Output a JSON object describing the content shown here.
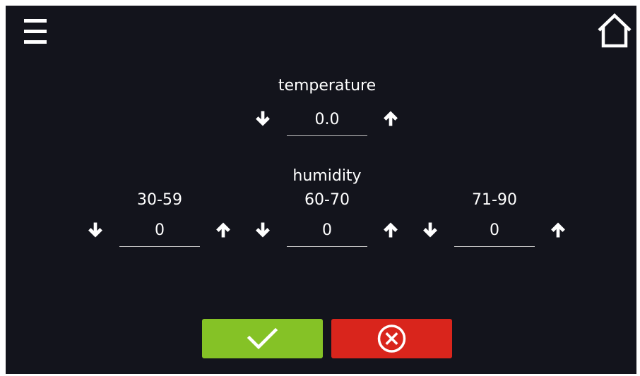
{
  "temperature": {
    "label": "temperature",
    "value": "0.0"
  },
  "humidity": {
    "label": "humidity",
    "ranges": [
      {
        "label": "30-59",
        "value": "0"
      },
      {
        "label": "60-70",
        "value": "0"
      },
      {
        "label": "71-90",
        "value": "0"
      }
    ]
  },
  "icons": {
    "menu": "hamburger-menu-icon",
    "home": "home-icon",
    "decrease": "arrow-down-icon",
    "increase": "arrow-up-icon",
    "confirm": "checkmark-icon",
    "cancel": "cancel-circle-x-icon"
  },
  "colors": {
    "background": "#13141c",
    "confirm_button": "#85c226",
    "cancel_button": "#d9251c",
    "text": "#ffffff"
  }
}
